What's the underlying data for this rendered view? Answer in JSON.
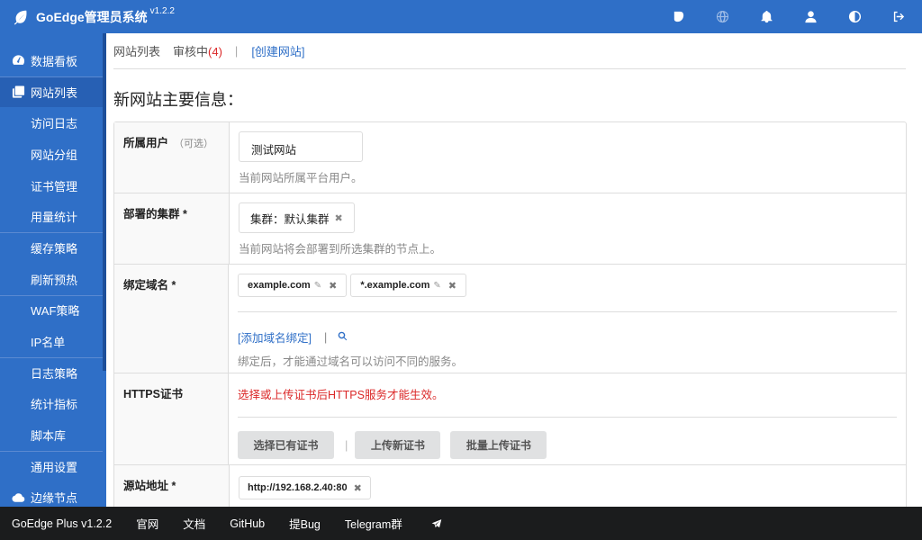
{
  "app": {
    "title": "GoEdge管理员系统",
    "version": "v1.2.2"
  },
  "topbar": {
    "icons": [
      "leaf-icon",
      "globe-icon",
      "bell-icon",
      "user-icon",
      "contrast-icon",
      "sign-out-icon"
    ]
  },
  "sidebar": {
    "items": [
      {
        "label": "数据看板",
        "icon": "dashboard-icon"
      },
      {
        "label": "网站列表",
        "icon": "clone-icon",
        "active": true
      },
      {
        "label": "访问日志"
      },
      {
        "label": "网站分组"
      },
      {
        "label": "证书管理"
      },
      {
        "label": "用量统计"
      },
      {
        "label": "缓存策略"
      },
      {
        "label": "刷新预热"
      },
      {
        "label": "WAF策略"
      },
      {
        "label": "IP名单"
      },
      {
        "label": "日志策略"
      },
      {
        "label": "统计指标"
      },
      {
        "label": "脚本库"
      },
      {
        "label": "通用设置"
      },
      {
        "label": "边缘节点",
        "icon": "cloud-icon"
      }
    ]
  },
  "tabs": {
    "list": "网站列表",
    "review": "审核中",
    "review_count": "(4)",
    "separator": "|",
    "create": "[创建网站]"
  },
  "heading": "新网站主要信息：",
  "form": {
    "user": {
      "label": "所属用户",
      "optional": "（可选）",
      "value": "测试网站",
      "hint": "当前网站所属平台用户。"
    },
    "cluster": {
      "label": "部署的集群 *",
      "chip": "集群：默认集群",
      "hint": "当前网站将会部署到所选集群的节点上。"
    },
    "domains": {
      "label": "绑定域名 *",
      "items": [
        "example.com",
        "*.example.com"
      ],
      "add_link": "[添加域名绑定]",
      "pipe": "|",
      "hint": "绑定后，才能通过域名可以访问不同的服务。"
    },
    "https": {
      "label": "HTTPS证书",
      "warning": "选择或上传证书后HTTPS服务才能生效。",
      "btn_select": "选择已有证书",
      "sep": "|",
      "btn_upload": "上传新证书",
      "btn_batch": "批量上传证书"
    },
    "origin": {
      "label": "源站地址 *",
      "value": "http://192.168.2.40:80"
    }
  },
  "footer": {
    "links": [
      "GoEdge Plus v1.2.2",
      "官网",
      "文档",
      "GitHub",
      "提Bug",
      "Telegram群"
    ]
  }
}
